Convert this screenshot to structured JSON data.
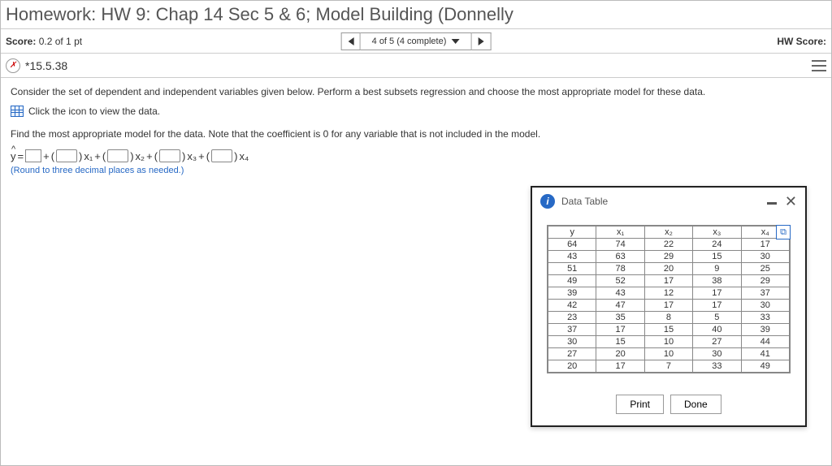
{
  "header": {
    "title": "Homework: HW 9: Chap 14 Sec 5 & 6; Model Building (Donnelly"
  },
  "scorebar": {
    "score_prefix": "Score:",
    "score_value": "0.2 of 1 pt",
    "nav_text": "4 of 5 (4 complete)",
    "hw_prefix": "HW Score:"
  },
  "question": {
    "id_label": "*15.5.38",
    "instruction1": "Consider the set of dependent and independent variables given below. Perform a best subsets regression and choose the most appropriate model for these data.",
    "dataset_link": "Click the icon to view the data.",
    "instruction2": "Find the most appropriate model for the data. Note that the coefficient is 0 for any variable that is not included in the model.",
    "eq_y": "y",
    "eq_eq": "=",
    "eq_plus": "+",
    "eq_x1": "x₁",
    "eq_x2": "x₂",
    "eq_x3": "x₃",
    "eq_x4": "x₄",
    "round_note": "(Round to three decimal places as needed.)"
  },
  "modal": {
    "title": "Data Table",
    "print_label": "Print",
    "done_label": "Done",
    "headers": {
      "y": "y",
      "x1": "x₁",
      "x2": "x₂",
      "x3": "x₃",
      "x4": "x₄"
    },
    "rows": [
      {
        "y": "64",
        "x1": "74",
        "x2": "22",
        "x3": "24",
        "x4": "17"
      },
      {
        "y": "43",
        "x1": "63",
        "x2": "29",
        "x3": "15",
        "x4": "30"
      },
      {
        "y": "51",
        "x1": "78",
        "x2": "20",
        "x3": "9",
        "x4": "25"
      },
      {
        "y": "49",
        "x1": "52",
        "x2": "17",
        "x3": "38",
        "x4": "29"
      },
      {
        "y": "39",
        "x1": "43",
        "x2": "12",
        "x3": "17",
        "x4": "37"
      },
      {
        "y": "42",
        "x1": "47",
        "x2": "17",
        "x3": "17",
        "x4": "30"
      },
      {
        "y": "23",
        "x1": "35",
        "x2": "8",
        "x3": "5",
        "x4": "33"
      },
      {
        "y": "37",
        "x1": "17",
        "x2": "15",
        "x3": "40",
        "x4": "39"
      },
      {
        "y": "30",
        "x1": "15",
        "x2": "10",
        "x3": "27",
        "x4": "44"
      },
      {
        "y": "27",
        "x1": "20",
        "x2": "10",
        "x3": "30",
        "x4": "41"
      },
      {
        "y": "20",
        "x1": "17",
        "x2": "7",
        "x3": "33",
        "x4": "49"
      }
    ]
  }
}
